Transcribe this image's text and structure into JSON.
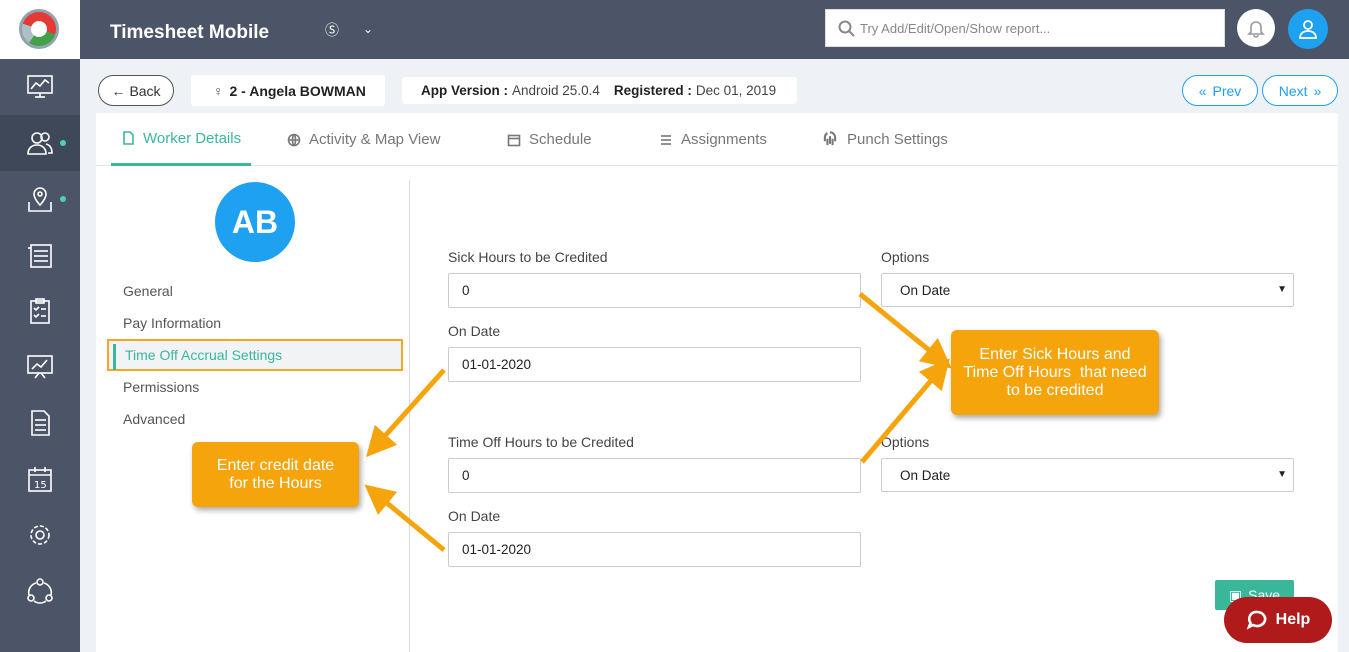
{
  "app": {
    "title": "Timesheet Mobile",
    "currency_icon": "currency-icon"
  },
  "search": {
    "placeholder": "Try Add/Edit/Open/Show report..."
  },
  "subheader": {
    "back_label": "Back",
    "worker": "2 - Angela BOWMAN",
    "app_version_label": "App Version :",
    "app_version_value": "Android 25.0.4",
    "registered_label": "Registered :",
    "registered_value": "Dec 01, 2019",
    "prev_label": "Prev",
    "next_label": "Next"
  },
  "tabs": [
    {
      "label": "Worker Details",
      "icon": "document-icon"
    },
    {
      "label": "Activity & Map View",
      "icon": "globe-icon"
    },
    {
      "label": "Schedule",
      "icon": "calendar-icon"
    },
    {
      "label": "Assignments",
      "icon": "list-icon"
    },
    {
      "label": "Punch Settings",
      "icon": "fingerprint-icon"
    }
  ],
  "avatar": {
    "initials": "AB"
  },
  "left_menu": [
    "General",
    "Pay Information",
    "Time Off Accrual Settings",
    "Permissions",
    "Advanced"
  ],
  "form": {
    "sick_hours_label": "Sick Hours to be Credited",
    "sick_hours_value": "0",
    "options_label_1": "Options",
    "options_value_1": "On Date",
    "on_date_label_1": "On Date",
    "on_date_value_1": "01-01-2020",
    "time_off_label": "Time Off Hours to be Credited",
    "time_off_value": "0",
    "options_label_2": "Options",
    "options_value_2": "On Date",
    "on_date_label_2": "On Date",
    "on_date_value_2": "01-01-2020",
    "save_label": "Save"
  },
  "callouts": {
    "left_line1": "Enter credit date",
    "left_line2": "for the Hours",
    "right_line1": "Enter Sick Hours and",
    "right_line2": "Time Off Hours  that need",
    "right_line3": "to be credited"
  },
  "help": {
    "label": "Help"
  },
  "colors": {
    "sidebar": "#4b5567",
    "accent": "#3ab79b",
    "blue": "#1ea1f0",
    "callout": "#f5a40c",
    "help": "#b01a1a"
  }
}
